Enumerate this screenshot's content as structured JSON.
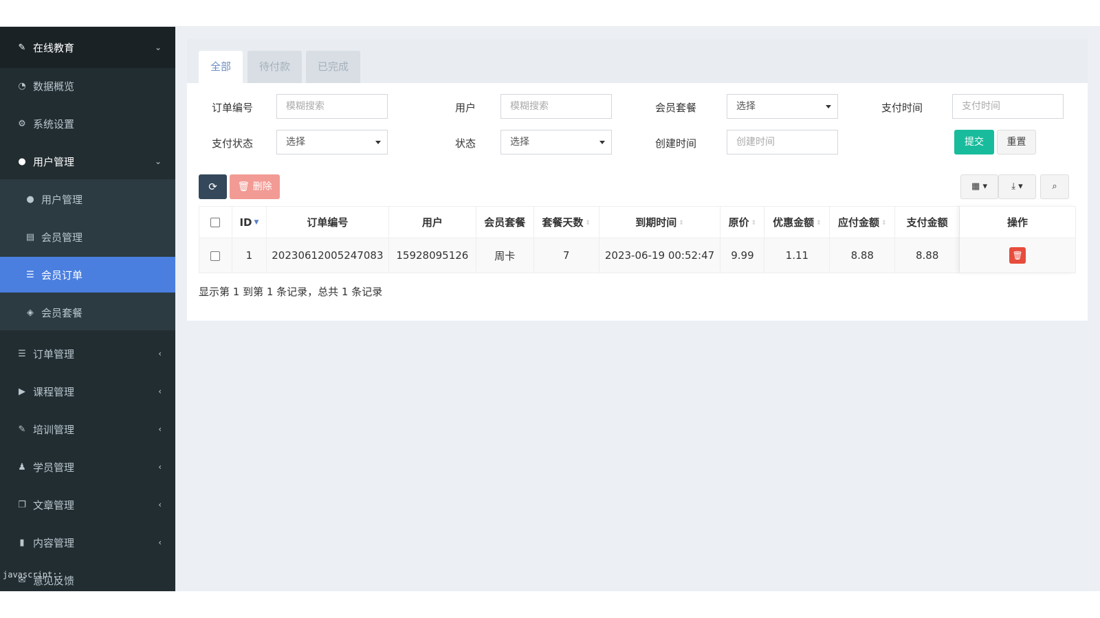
{
  "sidebar": {
    "header": {
      "label": "在线教育",
      "icon": "education-icon"
    },
    "items": [
      {
        "label": "数据概览",
        "icon": "dashboard-icon"
      },
      {
        "label": "系统设置",
        "icon": "cogs-icon"
      },
      {
        "label": "用户管理",
        "icon": "user-icon"
      },
      {
        "label": "用户管理",
        "icon": "user-icon"
      },
      {
        "label": "会员管理",
        "icon": "id-card-icon"
      },
      {
        "label": "会员订单",
        "icon": "list-icon"
      },
      {
        "label": "会员套餐",
        "icon": "cube-icon"
      },
      {
        "label": "订单管理",
        "icon": "list-icon"
      },
      {
        "label": "课程管理",
        "icon": "play-circle-icon"
      },
      {
        "label": "培训管理",
        "icon": "training-icon"
      },
      {
        "label": "学员管理",
        "icon": "student-icon"
      },
      {
        "label": "文章管理",
        "icon": "copy-icon"
      },
      {
        "label": "内容管理",
        "icon": "file-icon"
      },
      {
        "label": "意见反馈",
        "icon": "feedback-icon"
      }
    ],
    "js_status": "javascript:;"
  },
  "tabs": [
    "全部",
    "待付款",
    "已完成"
  ],
  "filters": {
    "order_no": {
      "label": "订单编号",
      "placeholder": "模糊搜索"
    },
    "user": {
      "label": "用户",
      "placeholder": "模糊搜索"
    },
    "package": {
      "label": "会员套餐",
      "value": "选择"
    },
    "pay_time": {
      "label": "支付时间",
      "placeholder": "支付时间"
    },
    "pay_status": {
      "label": "支付状态",
      "value": "选择"
    },
    "status": {
      "label": "状态",
      "value": "选择"
    },
    "create_time": {
      "label": "创建时间",
      "placeholder": "创建时间"
    },
    "submit": "提交",
    "reset": "重置"
  },
  "toolbar": {
    "delete": "删除"
  },
  "table": {
    "columns": [
      "ID",
      "订单编号",
      "用户",
      "会员套餐",
      "套餐天数",
      "到期时间",
      "原价",
      "优惠金额",
      "应付金额",
      "支付金额",
      "操作"
    ],
    "rows": [
      {
        "id": "1",
        "order_no": "20230612005247083",
        "user": "15928095126",
        "package": "周卡",
        "days": "7",
        "expire": "2023-06-19 00:52:47",
        "price": "9.99",
        "discount": "1.11",
        "payable": "8.88",
        "paid": "8.88"
      }
    ]
  },
  "footer": "显示第 1 到第 1 条记录，总共 1 条记录"
}
